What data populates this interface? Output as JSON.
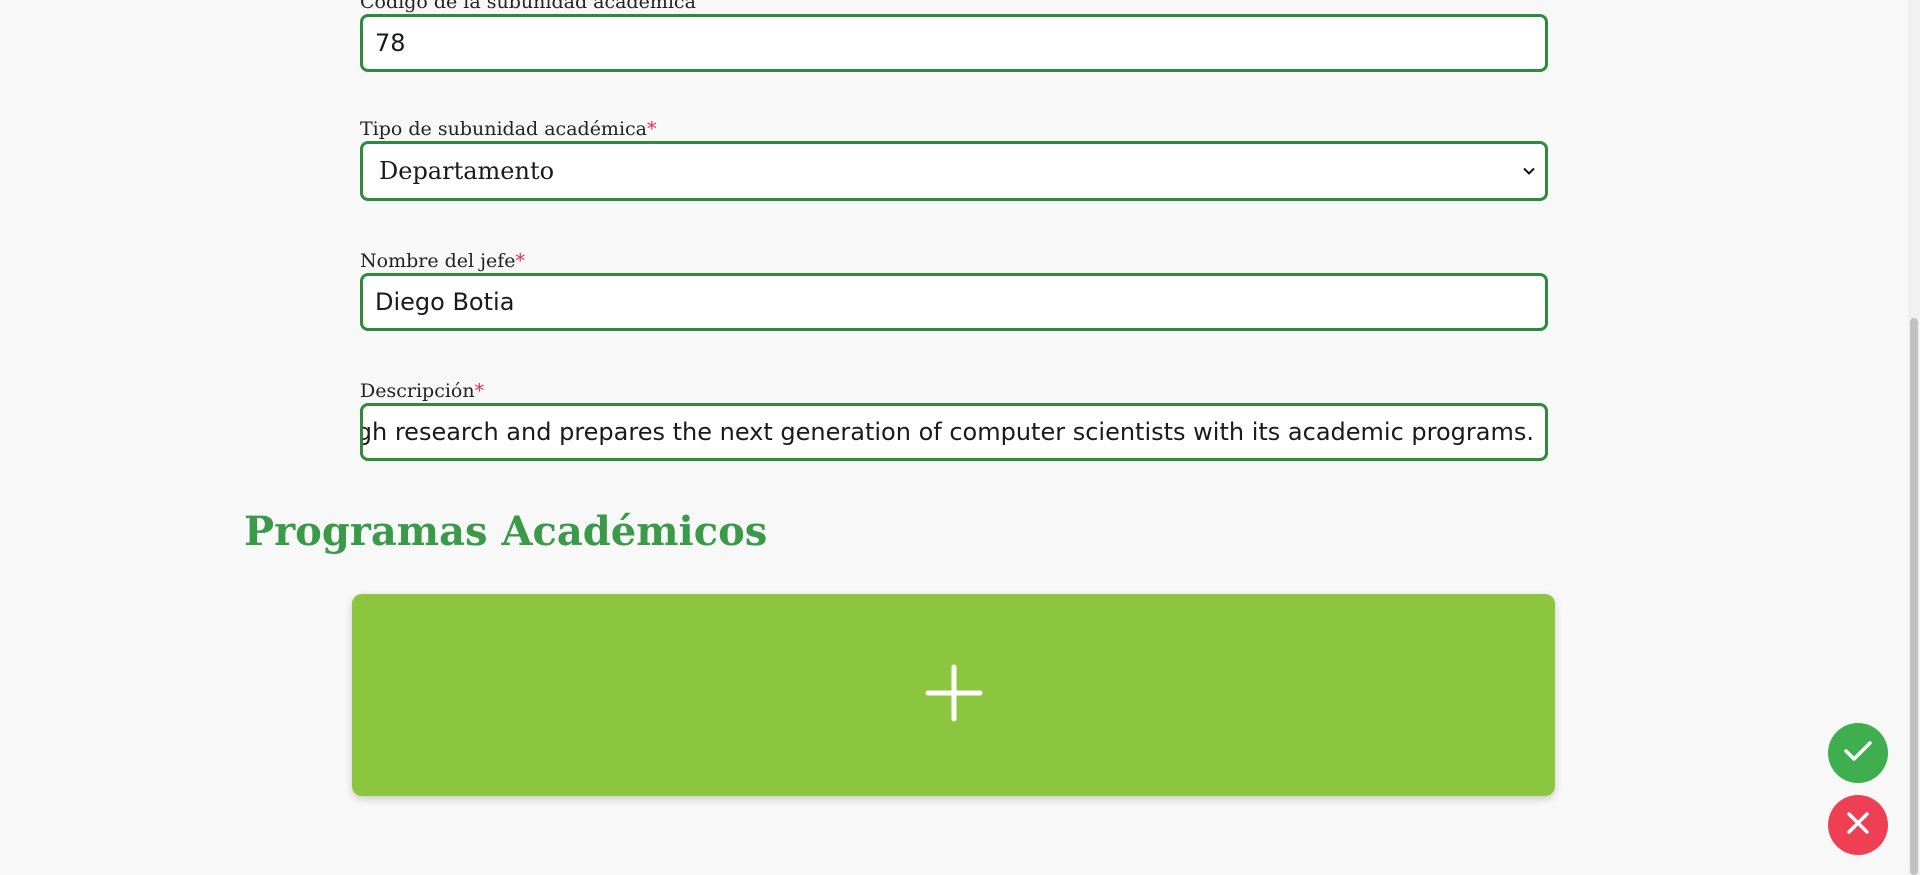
{
  "form": {
    "codigo": {
      "label": "Código de la subunidad académica",
      "value": "78"
    },
    "tipo": {
      "label": "Tipo de subunidad académica",
      "required_mark": "*",
      "selected": "Departamento"
    },
    "jefe": {
      "label": "Nombre del jefe",
      "required_mark": "*",
      "value": "Diego Botia"
    },
    "descripcion": {
      "label": "Descripción",
      "required_mark": "*",
      "value": "ough research and prepares the next generation of computer scientists with its academic programs."
    }
  },
  "programs": {
    "title": "Programas Académicos",
    "add_icon": "plus-icon"
  },
  "actions": {
    "confirm_icon": "check-icon",
    "cancel_icon": "close-icon"
  },
  "colors": {
    "accent_green": "#3a9a4a",
    "input_border": "#2e8b3e",
    "add_card": "#8cc63f",
    "confirm": "#3fae4f",
    "cancel": "#ef3f55",
    "required": "#d9304c"
  }
}
